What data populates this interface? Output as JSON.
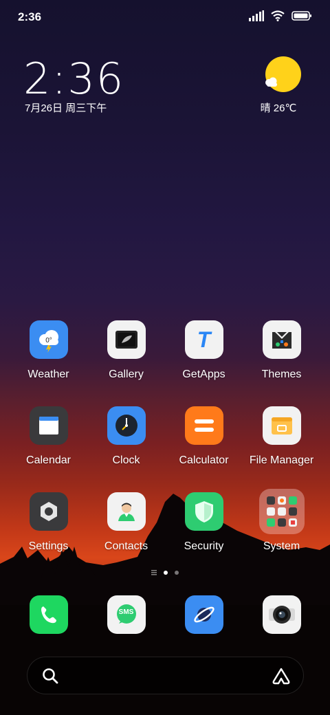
{
  "status_bar": {
    "time": "2:36",
    "icons": [
      "signal-icon",
      "wifi-icon",
      "battery-icon"
    ]
  },
  "lock_widget": {
    "time": "2:36",
    "date": "7月26日 周三下午"
  },
  "weather_widget": {
    "icon": "sun-cloud-icon",
    "text": "晴 26℃"
  },
  "apps": {
    "row1": [
      {
        "label": "Weather",
        "icon": "weather-icon",
        "temp": "0°"
      },
      {
        "label": "Gallery",
        "icon": "gallery-icon"
      },
      {
        "label": "GetApps",
        "icon": "getapps-icon",
        "letter": "T"
      },
      {
        "label": "Themes",
        "icon": "themes-icon"
      }
    ],
    "row2": [
      {
        "label": "Calendar",
        "icon": "calendar-icon"
      },
      {
        "label": "Clock",
        "icon": "clock-icon"
      },
      {
        "label": "Calculator",
        "icon": "calculator-icon"
      },
      {
        "label": "File Manager",
        "icon": "file-manager-icon"
      }
    ],
    "row3": [
      {
        "label": "Settings",
        "icon": "settings-icon"
      },
      {
        "label": "Contacts",
        "icon": "contacts-icon"
      },
      {
        "label": "Security",
        "icon": "security-icon"
      },
      {
        "label": "System",
        "icon": "system-folder-icon"
      }
    ]
  },
  "page_indicator": {
    "pages": 2,
    "current": 1
  },
  "dock": [
    {
      "icon": "phone-icon"
    },
    {
      "icon": "sms-icon",
      "text": "SMS"
    },
    {
      "icon": "browser-icon"
    },
    {
      "icon": "camera-icon"
    }
  ],
  "search_bar": {
    "left_icon": "search-icon",
    "right_icon": "assistant-icon"
  },
  "colors": {
    "sun": "#ffd21a",
    "weather_bg": "#3b8df2",
    "getapps_letter": "#2a86f5",
    "calculator_bg": "#ff7a1a",
    "security_bg": "#2ecc71",
    "phone_bg": "#1ed760"
  }
}
